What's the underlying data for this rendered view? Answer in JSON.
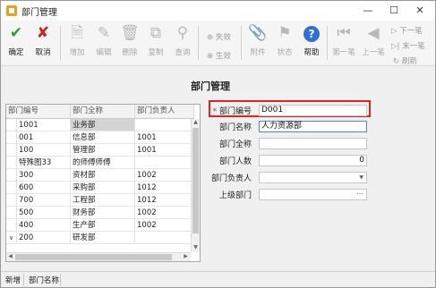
{
  "window": {
    "title": "部门管理"
  },
  "toolbar": {
    "confirm": "确定",
    "cancel": "取消",
    "add": "增加",
    "edit": "编辑",
    "delete": "删除",
    "copy": "复制",
    "query": "查询",
    "invalidate": "失效",
    "activate": "生效",
    "attach": "附件",
    "status": "状态",
    "help": "帮助",
    "first": "第一笔",
    "prev": "上一笔",
    "next": "下一笔",
    "last": "末一笔",
    "refresh": "刷新"
  },
  "heading": "部门管理",
  "grid": {
    "columns": [
      "部门编号",
      "部门全称",
      "部门负责人"
    ],
    "rows": [
      {
        "code": "1001",
        "name": "业务部",
        "owner": ""
      },
      {
        "code": "001",
        "name": "信息部",
        "owner": "1001"
      },
      {
        "code": "100",
        "name": "管理部",
        "owner": "1001"
      },
      {
        "code": "特殊图33",
        "name": "的师傅师傅",
        "owner": ""
      },
      {
        "code": "300",
        "name": "资材部",
        "owner": "1002"
      },
      {
        "code": "600",
        "name": "采购部",
        "owner": "1012"
      },
      {
        "code": "700",
        "name": "工程部",
        "owner": "1012"
      },
      {
        "code": "500",
        "name": "财务部",
        "owner": "1002"
      },
      {
        "code": "400",
        "name": "生产部",
        "owner": "1002"
      },
      {
        "code": "200",
        "name": "研发部",
        "owner": ""
      }
    ]
  },
  "form": {
    "required_mark": "*",
    "dept_code_label": "部门编号",
    "dept_code_value": "D001",
    "dept_name_label": "部门名称",
    "dept_name_value": "人力资源部",
    "dept_fullname_label": "部门全称",
    "dept_fullname_value": "",
    "headcount_label": "部门人数",
    "headcount_value": "0",
    "manager_label": "部门负责人",
    "manager_value": "",
    "parent_label": "上级部门",
    "parent_value": ""
  },
  "statusbar": {
    "mode": "新增",
    "field": "部门名称"
  },
  "colors": {
    "accent_red": "#e02424",
    "help_blue": "#2f6fd6",
    "confirm_green": "#2e9c3a"
  }
}
